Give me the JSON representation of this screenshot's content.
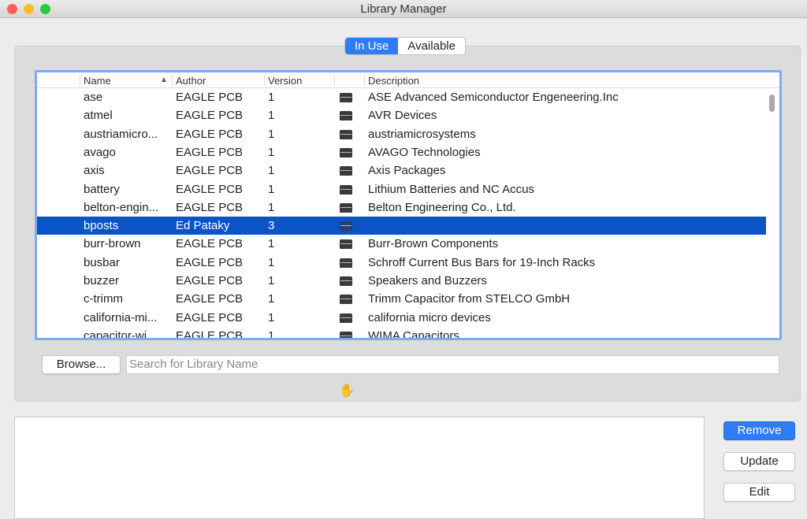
{
  "window": {
    "title": "Library Manager"
  },
  "tabs": [
    {
      "label": "In Use",
      "active": true
    },
    {
      "label": "Available",
      "active": false
    }
  ],
  "table": {
    "columns": [
      "Name",
      "Author",
      "Version",
      "",
      "Description"
    ],
    "rows": [
      {
        "name": "ase",
        "author": "EAGLE PCB",
        "version": "1",
        "description": "ASE Advanced Semiconductor Engeneering.Inc"
      },
      {
        "name": "atmel",
        "author": "EAGLE PCB",
        "version": "1",
        "description": "AVR Devices"
      },
      {
        "name": "austriamicro...",
        "author": "EAGLE PCB",
        "version": "1",
        "description": "austriamicrosystems"
      },
      {
        "name": "avago",
        "author": "EAGLE PCB",
        "version": "1",
        "description": "AVAGO Technologies"
      },
      {
        "name": "axis",
        "author": "EAGLE PCB",
        "version": "1",
        "description": "Axis Packages"
      },
      {
        "name": "battery",
        "author": "EAGLE PCB",
        "version": "1",
        "description": "Lithium Batteries and NC Accus"
      },
      {
        "name": "belton-engin...",
        "author": "EAGLE PCB",
        "version": "1",
        "description": "Belton Engineering Co., Ltd."
      },
      {
        "name": "bposts",
        "author": "Ed Pataky",
        "version": "3",
        "description": "",
        "selected": true
      },
      {
        "name": "burr-brown",
        "author": "EAGLE PCB",
        "version": "1",
        "description": "Burr-Brown Components"
      },
      {
        "name": "busbar",
        "author": "EAGLE PCB",
        "version": "1",
        "description": "Schroff Current Bus Bars for 19-Inch Racks"
      },
      {
        "name": "buzzer",
        "author": "EAGLE PCB",
        "version": "1",
        "description": "Speakers and Buzzers"
      },
      {
        "name": "c-trimm",
        "author": "EAGLE PCB",
        "version": "1",
        "description": "Trimm Capacitor from STELCO GmbH"
      },
      {
        "name": "california-mi...",
        "author": "EAGLE PCB",
        "version": "1",
        "description": "california micro devices"
      },
      {
        "name": "capacitor-wi...",
        "author": "EAGLE PCB",
        "version": "1",
        "description": "WIMA Capacitors"
      }
    ]
  },
  "browse_label": "Browse...",
  "search": {
    "placeholder": "Search for Library Name",
    "value": ""
  },
  "actions": {
    "remove": "Remove",
    "update": "Update",
    "edit": "Edit"
  }
}
